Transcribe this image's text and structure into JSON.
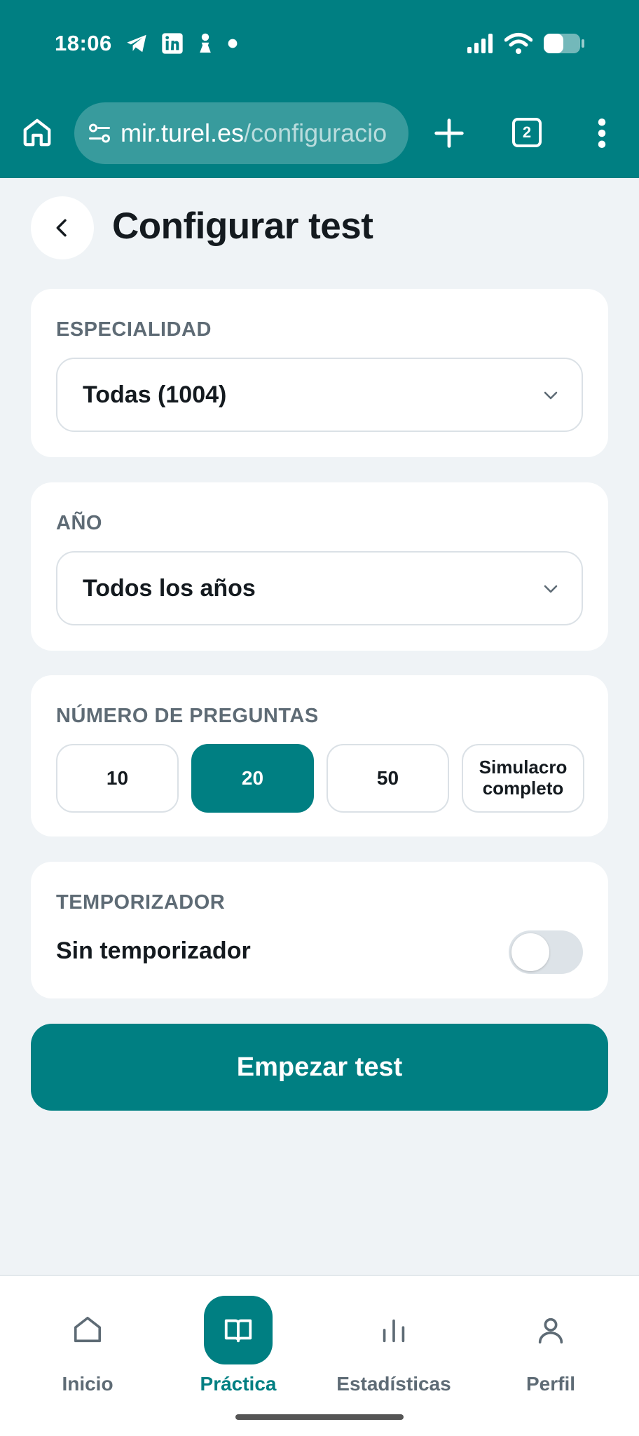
{
  "status_bar": {
    "time": "18:06",
    "left_icons": [
      "telegram-icon",
      "linkedin-icon",
      "chess-pawn-icon",
      "dot-icon"
    ],
    "right_icons": [
      "signal-icon",
      "wifi-icon",
      "battery-icon"
    ]
  },
  "browser": {
    "url_domain": "mir.turel.es",
    "url_path": "/configuracio",
    "tab_count": "2"
  },
  "header": {
    "title": "Configurar test"
  },
  "specialty": {
    "label": "ESPECIALIDAD",
    "value": "Todas (1004)"
  },
  "year": {
    "label": "AÑO",
    "value": "Todos los años"
  },
  "question_count": {
    "label": "NÚMERO DE PREGUNTAS",
    "options": [
      "10",
      "20",
      "50",
      "Simulacro\ncompleto"
    ],
    "selected": "20"
  },
  "timer": {
    "label": "TEMPORIZADOR",
    "value_text": "Sin temporizador",
    "enabled": false
  },
  "start_button": {
    "label": "Empezar test"
  },
  "bottom_nav": {
    "items": [
      {
        "label": "Inicio",
        "icon": "home-icon"
      },
      {
        "label": "Práctica",
        "icon": "book-icon"
      },
      {
        "label": "Estadísticas",
        "icon": "bar-chart-icon"
      },
      {
        "label": "Perfil",
        "icon": "user-icon"
      }
    ],
    "active": "Práctica"
  },
  "colors": {
    "primary": "#007f82",
    "background": "#eff3f6",
    "muted_text": "#5e6b75"
  }
}
